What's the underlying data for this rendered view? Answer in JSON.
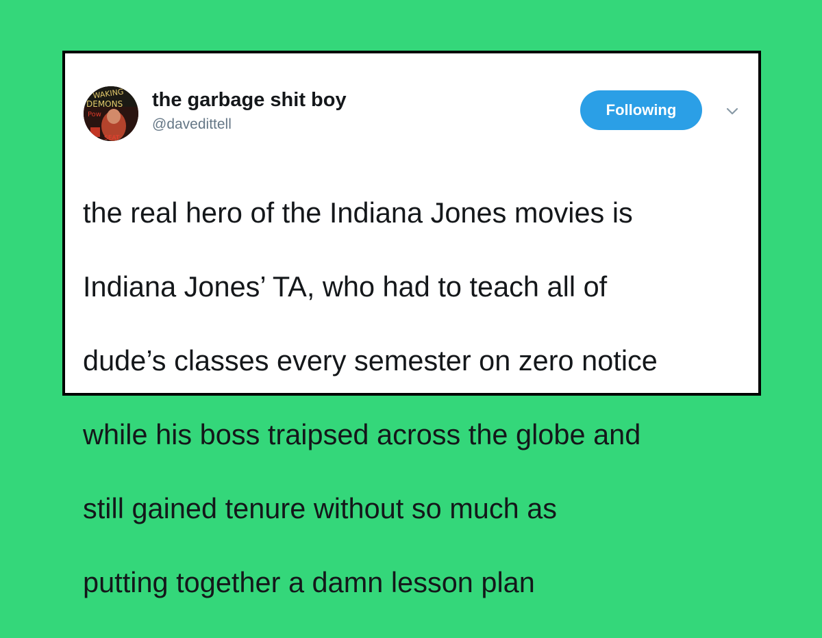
{
  "colors": {
    "background": "#34d77a",
    "card_border": "#000000",
    "follow_button": "#2b9fe6",
    "handle_text": "#657786",
    "body_text": "#14171a"
  },
  "tweet": {
    "author": {
      "display_name": "the garbage shit boy",
      "handle": "@davedittell",
      "avatar_icon": "user-avatar"
    },
    "follow_button_label": "Following",
    "menu_icon": "chevron-down-icon",
    "text_lines": [
      "the real hero of the Indiana Jones movies is",
      "Indiana Jones’ TA, who had to teach all of",
      "dude’s classes every semester on zero notice",
      "while his boss traipsed across the globe and",
      "still gained tenure without so much as",
      "putting together a damn lesson plan"
    ]
  }
}
